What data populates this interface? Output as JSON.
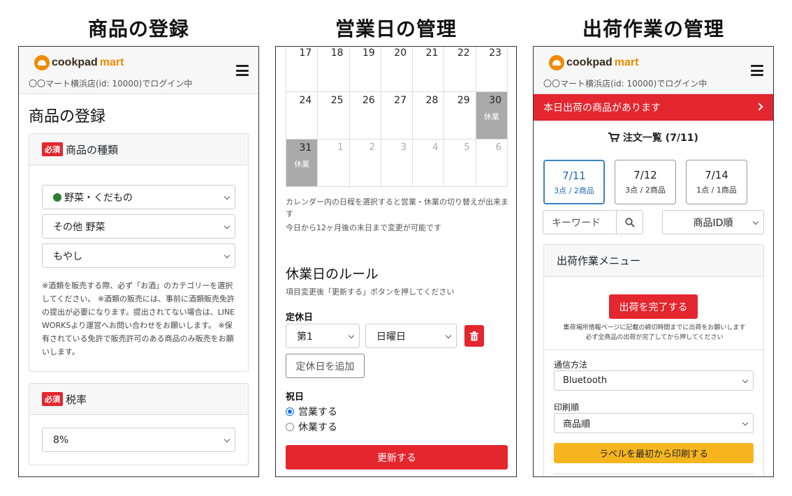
{
  "captions": [
    "商品の登録",
    "営業日の管理",
    "出荷作業の管理"
  ],
  "brand": {
    "part1": "cookpad",
    "part2": "mart",
    "accent": "#f08a00"
  },
  "login_text": "〇〇マート横浜店(id: 10000)でログイン中",
  "colors": {
    "red": "#e4262e",
    "blue": "#1f67b5",
    "yellow": "#f7b520",
    "gray_holiday": "#aaaaaa"
  },
  "product": {
    "title": "商品の登録",
    "required": "必須",
    "type_label": "商品の種類",
    "selects": [
      "野菜・くだもの",
      "その他 野菜",
      "もやし"
    ],
    "note": "※酒類を販売する際、必ず「お酒」のカテゴリーを選択してください。 ※酒類の販売には、事前に酒類販売免許の提出が必要になります。提出されてない場合は、LINE WORKSより運営へお問い合わせをお願いします。 ※保有されている免許で販売許可のある商品のみ販売をお願いします。",
    "tax_label": "税率",
    "tax_value": "8%"
  },
  "calendar": {
    "rows": [
      [
        {
          "d": "17"
        },
        {
          "d": "18"
        },
        {
          "d": "19"
        },
        {
          "d": "20"
        },
        {
          "d": "21"
        },
        {
          "d": "22"
        },
        {
          "d": "23"
        }
      ],
      [
        {
          "d": "24"
        },
        {
          "d": "25"
        },
        {
          "d": "26"
        },
        {
          "d": "27"
        },
        {
          "d": "28"
        },
        {
          "d": "29"
        },
        {
          "d": "30",
          "holiday": true
        }
      ],
      [
        {
          "d": "31",
          "holiday": true
        },
        {
          "d": "1",
          "dim": true
        },
        {
          "d": "2",
          "dim": true
        },
        {
          "d": "3",
          "dim": true
        },
        {
          "d": "4",
          "dim": true
        },
        {
          "d": "5",
          "dim": true
        },
        {
          "d": "6",
          "dim": true
        }
      ]
    ],
    "holiday_tag": "休業",
    "note1": "カレンダー内の日程を選択すると営業・休業の切り替えが出来ます",
    "note2": "今日から12ヶ月後の末日まで変更が可能です",
    "rules_title": "休業日のルール",
    "rules_note": "項目変更後「更新する」ボタンを押してください",
    "fixed_label": "定休日",
    "week_value": "第1",
    "day_value": "日曜日",
    "add_button": "定休日を追加",
    "national_label": "祝日",
    "radio_open": "営業する",
    "radio_closed": "休業する",
    "update_button": "更新する"
  },
  "shipping": {
    "alert": "本日出荷の商品があります",
    "orders_title": "注文一覧 (7/11)",
    "dates": [
      {
        "date": "7/11",
        "sub": "3点 / 2商品",
        "active": true
      },
      {
        "date": "7/12",
        "sub": "3点 / 2商品",
        "active": false
      },
      {
        "date": "7/14",
        "sub": "1点 / 1商品",
        "active": false
      }
    ],
    "keyword_placeholder": "キーワード",
    "sort_value": "商品ID順",
    "menu_title": "出荷作業メニュー",
    "complete_button": "出荷を完了する",
    "complete_note1": "集荷場所情報ページに記載の締切時間までに出荷をお願いします",
    "complete_note2": "必ず全商品の出荷が完了してから押してください",
    "comm_label": "通信方法",
    "comm_value": "Bluetooth",
    "print_label": "印刷順",
    "print_value": "商品順",
    "print_button": "ラベルを最初から印刷する"
  }
}
